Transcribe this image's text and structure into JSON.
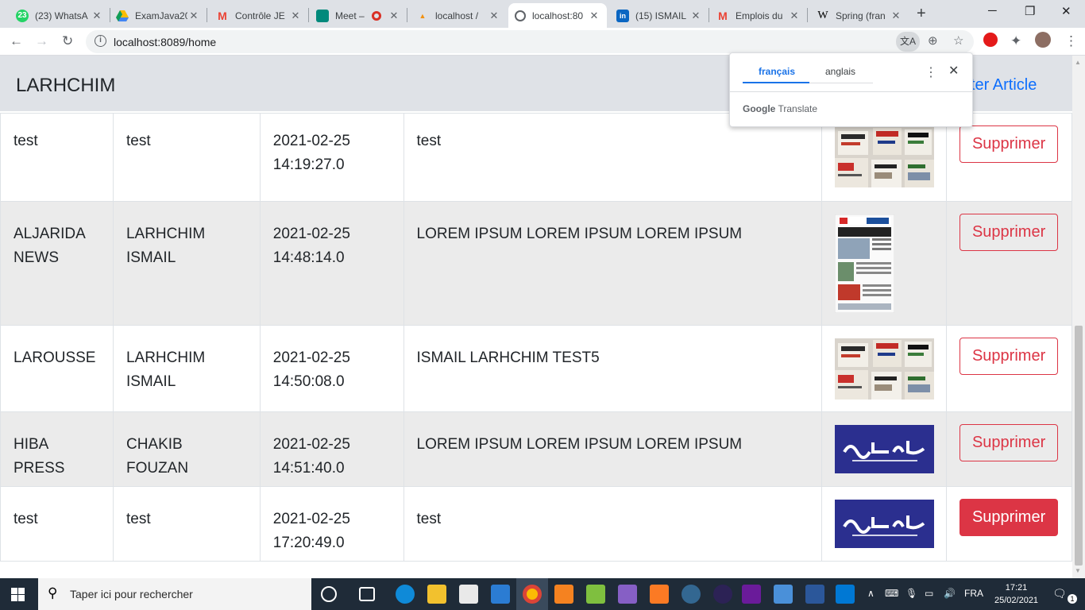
{
  "browser": {
    "tabs": [
      {
        "title": "(23) WhatsA",
        "favicon": "whatsapp-icon",
        "color": "#25d366",
        "badge": "23"
      },
      {
        "title": "ExamJava20",
        "favicon": "drive-icon",
        "color": "#fbbc04"
      },
      {
        "title": "Contrôle JE",
        "favicon": "gmail-icon",
        "color": "#ea4335"
      },
      {
        "title": "Meet –",
        "favicon": "meet-icon",
        "color": "#00897b"
      },
      {
        "title": "localhost /",
        "favicon": "phpmyadmin-icon",
        "color": "#f29111"
      },
      {
        "title": "localhost:80",
        "favicon": "globe-icon",
        "color": "#5f6368"
      },
      {
        "title": "(15) ISMAIL",
        "favicon": "linkedin-icon",
        "color": "#0a66c2"
      },
      {
        "title": "Emplois du",
        "favicon": "gmail-icon",
        "color": "#ea4335"
      },
      {
        "title": "Spring (fran",
        "favicon": "wikipedia-icon",
        "color": "#000000"
      }
    ],
    "url": "localhost:8089/home"
  },
  "translate_popup": {
    "lang_source": "français",
    "lang_target": "anglais",
    "footer_brand": "Google",
    "footer_text": "Translate"
  },
  "navbar": {
    "brand": "LARHCHIM",
    "link": "ter Article"
  },
  "articles": [
    {
      "journal": "test",
      "author": "test",
      "date": "2021-02-25",
      "time": "14:19:27.0",
      "content": "test",
      "image": "newspapers-photo",
      "action": "Supprimer"
    },
    {
      "journal": "ALJARIDA NEWS",
      "author": "LARHCHIM ISMAIL",
      "date": "2021-02-25",
      "time": "14:48:14.0",
      "content": "LOREM IPSUM LOREM IPSUM LOREM IPSUM",
      "image": "aljarida-front-page",
      "action": "Supprimer"
    },
    {
      "journal": "LAROUSSE",
      "author": "LARHCHIM ISMAIL",
      "date": "2021-02-25",
      "time": "14:50:08.0",
      "content": "ISMAIL LARHCHIM TEST5",
      "image": "newspapers-photo",
      "action": "Supprimer"
    },
    {
      "journal": "HIBA PRESS",
      "author": "CHAKIB FOUZAN",
      "date": "2021-02-25",
      "time": "14:51:40.0",
      "content": "LOREM IPSUM LOREM IPSUM LOREM IPSUM",
      "image": "hespress-logo",
      "action": "Supprimer"
    },
    {
      "journal": "test",
      "author": "test",
      "date": "2021-02-25",
      "time": "17:20:49.0",
      "content": "test",
      "image": "hespress-logo",
      "action": "Supprimer"
    }
  ],
  "taskbar": {
    "search_placeholder": "Taper ici pour rechercher",
    "lang": "FRA",
    "time": "17:21",
    "date": "25/02/2021",
    "notifications": "1"
  },
  "colors": {
    "danger": "#dc3545",
    "link": "#0d6efd",
    "navbar_bg": "#dfe2e7",
    "hespress_blue": "#2b2f8f"
  }
}
